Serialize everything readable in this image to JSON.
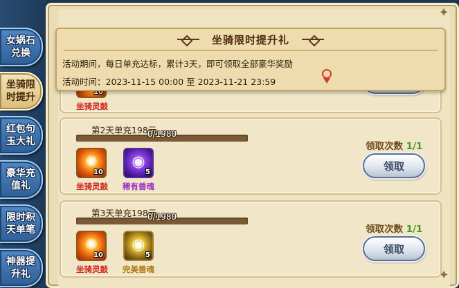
{
  "tabs": [
    {
      "label": "女娲石兑换",
      "active": false
    },
    {
      "label": "坐骑限时提升",
      "active": true
    },
    {
      "label": "红包句玉大礼",
      "active": false
    },
    {
      "label": "豪华充值礼",
      "active": false
    },
    {
      "label": "限时积天单笔",
      "active": false
    },
    {
      "label": "神器提升礼",
      "active": false
    }
  ],
  "banner": {
    "title": "坐骑限时提升礼",
    "description": "活动期间，每日单充达标，累计3天，即可领取全部豪华奖励",
    "time": "活动时间：2023-11-15 00:00 至 2023-11-21 23:59"
  },
  "card_partial": {
    "items": [
      {
        "count": "10",
        "name": "坐骑灵鼓",
        "color": "orange"
      }
    ]
  },
  "cards": [
    {
      "title": "第2天单充198元",
      "progress_text": "0/1980",
      "progress": 0,
      "claim_label": "领取次数",
      "claim_count": "1/1",
      "claim_button": "领取",
      "items": [
        {
          "count": "10",
          "name": "坐骑灵鼓",
          "color": "orange"
        },
        {
          "count": "5",
          "name": "稀有兽魂",
          "color": "purple"
        }
      ]
    },
    {
      "title": "第3天单充198元",
      "progress_text": "0/1980",
      "progress": 0,
      "claim_label": "领取次数",
      "claim_count": "1/1",
      "claim_button": "领取",
      "items": [
        {
          "count": "10",
          "name": "坐骑灵鼓",
          "color": "orange"
        },
        {
          "count": "5",
          "name": "完美兽魂",
          "color": "gold"
        }
      ]
    }
  ],
  "colors": {
    "accent": "#d0201a",
    "claim_green": "#3f9a22",
    "panel": "#efe4c2"
  }
}
